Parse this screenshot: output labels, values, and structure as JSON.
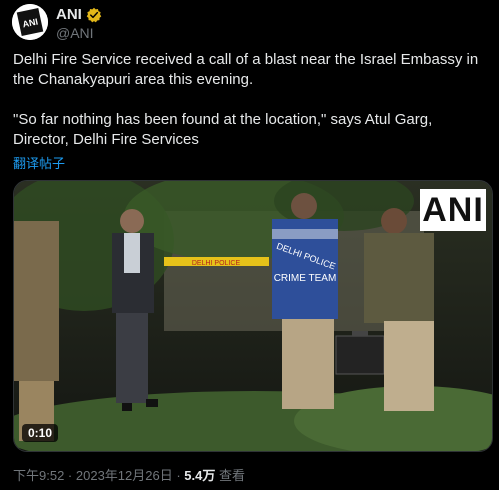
{
  "account": {
    "name": "ANI",
    "handle": "@ANI",
    "avatar_text": "ANI"
  },
  "tweet": {
    "paragraph1": "Delhi Fire Service received a call of a blast near the Israel Embassy in the Chanakyapuri area this evening.",
    "paragraph2": "\"So far nothing has been found at the location,\" says Atul Garg, Director, Delhi Fire Services",
    "translate_label": "翻译帖子"
  },
  "media": {
    "watermark": "ANI",
    "duration": "0:10",
    "scene_text": {
      "tape": "DELHI POLICE",
      "jacket_line1": "DELHI POLICE",
      "jacket_line2": "CRIME TEAM"
    }
  },
  "meta": {
    "time": "下午9:52",
    "separator1": " · ",
    "date": "2023年12月26日",
    "separator2": " · ",
    "views": "5.4万",
    "views_label": " 查看"
  },
  "colors": {
    "accent": "#1d9bf0",
    "verified_badge": "#e2b719",
    "background": "#000000",
    "text": "#e7e9ea",
    "secondary_text": "#71767b"
  },
  "icons": {
    "verified": "verified-badge-icon",
    "avatar": "ani-logo-icon"
  }
}
